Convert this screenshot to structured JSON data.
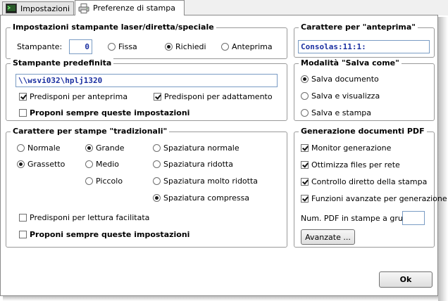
{
  "tabs": [
    {
      "label": "Impostazioni"
    },
    {
      "label": "Preferenze di stampa"
    }
  ],
  "printer_settings": {
    "title": "Impostazioni stampante laser/diretta/speciale",
    "stampante_label": "Stampante:",
    "stampante_value": "0",
    "options": [
      "Fissa",
      "Richiedi",
      "Anteprima"
    ],
    "selected": "Richiedi"
  },
  "default_printer": {
    "title": "Stampante predefinita",
    "path": "\\\\wsvi032\\hplj1320",
    "checkbox_preview": "Predisponi per anteprima",
    "checkbox_fit": "Predisponi per adattamento",
    "checkbox_propose": "Proponi sempre queste impostazioni"
  },
  "traditional_chars": {
    "title": "Carattere per stampe \"tradizionali\"",
    "style_options": [
      "Normale",
      "Grassetto"
    ],
    "style_selected": "Grassetto",
    "size_options": [
      "Grande",
      "Medio",
      "Piccolo"
    ],
    "size_selected": "Grande",
    "spacing_options": [
      "Spaziatura normale",
      "Spaziatura ridotta",
      "Spaziatura molto ridotta",
      "Spaziatura compressa"
    ],
    "spacing_selected": "Spaziatura compressa",
    "checkbox_easy_read": "Predisponi per lettura facilitata",
    "checkbox_propose": "Proponi sempre queste impostazioni"
  },
  "preview_char": {
    "title": "Carattere per \"anteprima\"",
    "value": "Consolas:11:1:"
  },
  "save_as": {
    "title": "Modalità \"Salva come\"",
    "options": [
      "Salva documento",
      "Salva e visualizza",
      "Salva e stampa"
    ],
    "selected": "Salva documento"
  },
  "pdf": {
    "title": "Generazione documenti PDF",
    "checkboxes": [
      "Monitor generazione",
      "Ottimizza files per rete",
      "Controllo diretto della stampa",
      "Funzioni avanzate per generazione"
    ],
    "group_label": "Num. PDF in stampe a gruppi:",
    "group_value": "",
    "advanced_button": "Avanzate ..."
  },
  "ok_button": "Ok"
}
